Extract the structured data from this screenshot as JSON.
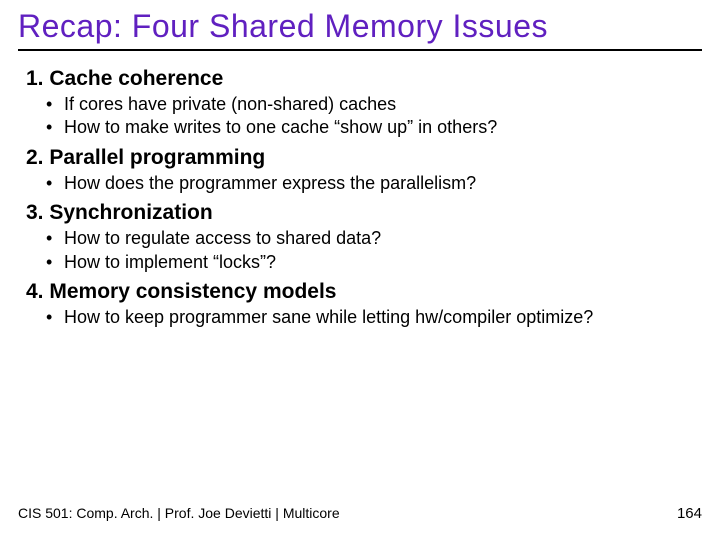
{
  "title": "Recap: Four Shared Memory Issues",
  "items": [
    {
      "num": "1.",
      "heading": "Cache coherence",
      "bullets": [
        "If cores have private (non-shared) caches",
        "How to make writes to one cache “show up” in others?"
      ]
    },
    {
      "num": "2.",
      "heading": "Parallel programming",
      "bullets": [
        "How does the programmer express the parallelism?"
      ]
    },
    {
      "num": "3.",
      "heading": "Synchronization",
      "bullets": [
        "How to regulate access to shared data?",
        "How to implement “locks”?"
      ]
    },
    {
      "num": "4.",
      "heading": "Memory consistency models",
      "bullets": [
        "How to keep programmer sane while letting hw/compiler optimize?"
      ]
    }
  ],
  "footer": {
    "left": "CIS 501: Comp. Arch.  |  Prof. Joe Devietti  |  Multicore",
    "right": "164"
  }
}
